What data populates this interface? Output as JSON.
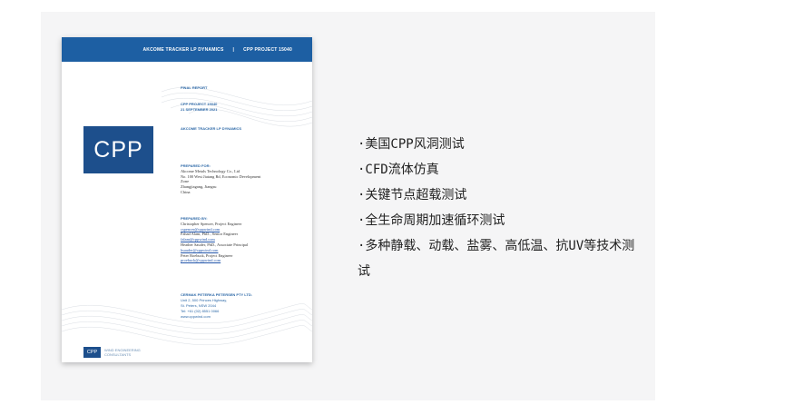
{
  "report": {
    "banner_left": "AKCOME TRACKER LP DYNAMICS",
    "banner_sep": "|",
    "banner_right": "CPP PROJECT 15040",
    "doc_type": "FINAL REPORT",
    "project": "CPP PROJECT 15040",
    "date": "21 SEPTEMBER 2021",
    "subject": "AKCOME TRACKER LP DYNAMICS",
    "logo": "CPP",
    "prepared_for_head": "PREPARED FOR:",
    "prepared_for": [
      "Akcome Metals Technology Co., Ltd",
      "No. 100 West Jiatang Rd, Economic Development",
      "Zone",
      "Zhangjiagang, Jiangsu",
      "China"
    ],
    "prepared_by_head": "PREPARED BY:",
    "people": [
      {
        "line": "Christopher Spencer, Project Engineer",
        "email": "cspencer@cppwind.com"
      },
      {
        "line": "Fahad Alam, PhD., Senior Engineer",
        "email": "falam@cppwind.com"
      },
      {
        "line": "Heather Sauder, PhD., Associate Principal",
        "email": "hsauder@cppwind.com"
      },
      {
        "line": "Peter Roebuck, Project Engineer",
        "email": "proebuck@cppwind.com"
      }
    ],
    "address": [
      "CERMAK PETERKA PETERSEN PTY LTD.",
      "Unit 2, 500 Princes Highway,",
      "St. Peters, NSW 2044",
      "Tel: +61 (02) 8551 0066",
      "www.cppwind.com"
    ],
    "footer_logo": "CPP",
    "footer_line1": "WIND ENGINEERING",
    "footer_line2": "CONSULTANTS"
  },
  "bullets": [
    "·美国CPP风洞测试",
    "·CFD流体仿真",
    "·关键节点超载测试",
    "·全生命周期加速循环测试",
    "·多种静载、动载、盐雾、高低温、抗UV等技术测试"
  ]
}
